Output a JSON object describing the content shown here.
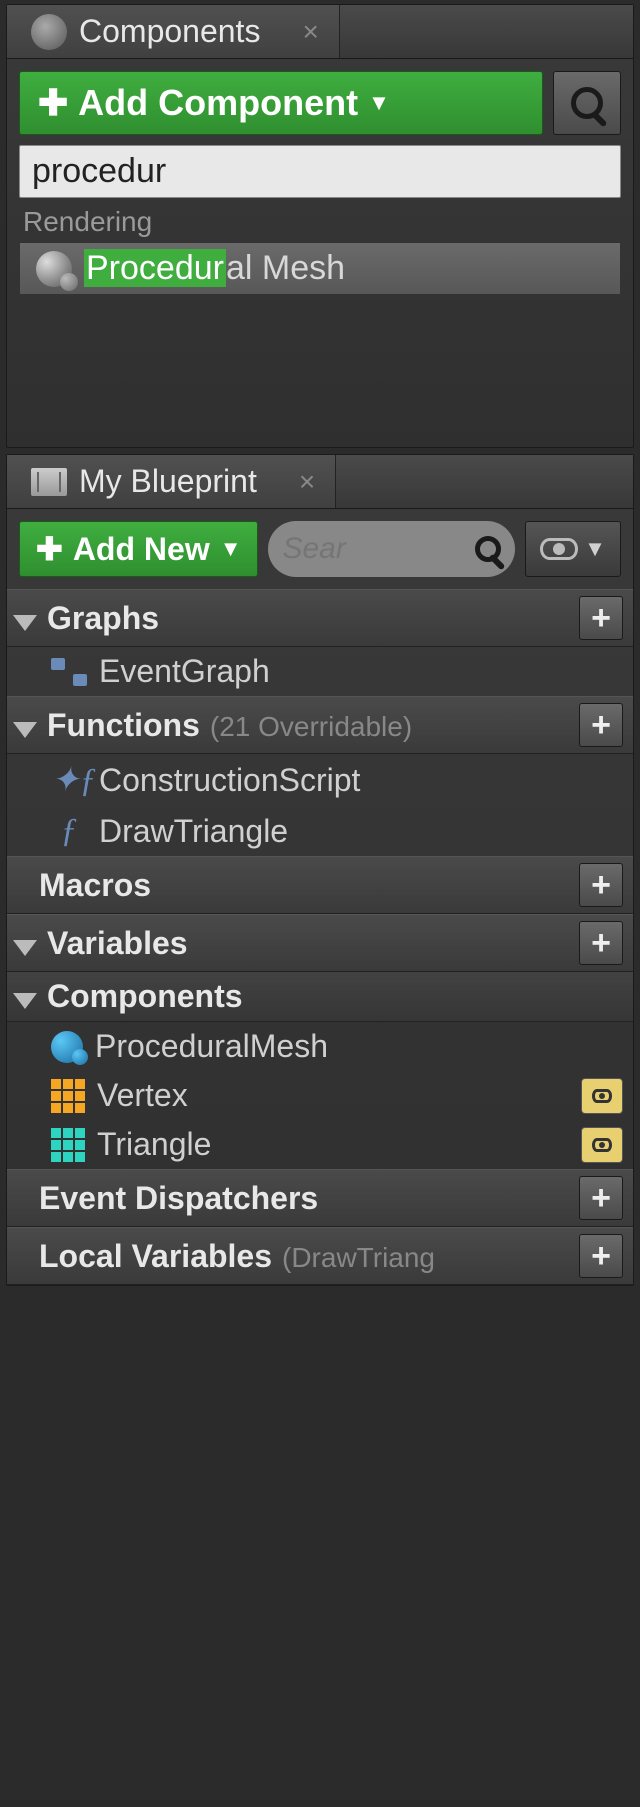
{
  "components_panel": {
    "title": "Components",
    "add_button": "Add Component",
    "search_value": "procedur",
    "category": "Rendering",
    "result_highlight": "Procedur",
    "result_rest": "al Mesh"
  },
  "blueprint_panel": {
    "title": "My Blueprint",
    "add_button": "Add New",
    "search_placeholder": "Sear",
    "sections": {
      "graphs": {
        "title": "Graphs",
        "items": [
          "EventGraph"
        ]
      },
      "functions": {
        "title": "Functions",
        "sub": "(21 Overridable)",
        "items": [
          "ConstructionScript",
          "DrawTriangle"
        ]
      },
      "macros": {
        "title": "Macros"
      },
      "variables": {
        "title": "Variables"
      },
      "components": {
        "title": "Components",
        "items": [
          "ProceduralMesh",
          "Vertex",
          "Triangle"
        ]
      },
      "event_dispatchers": {
        "title": "Event Dispatchers"
      },
      "local_variables": {
        "title": "Local Variables",
        "sub": "(DrawTriang"
      }
    }
  }
}
